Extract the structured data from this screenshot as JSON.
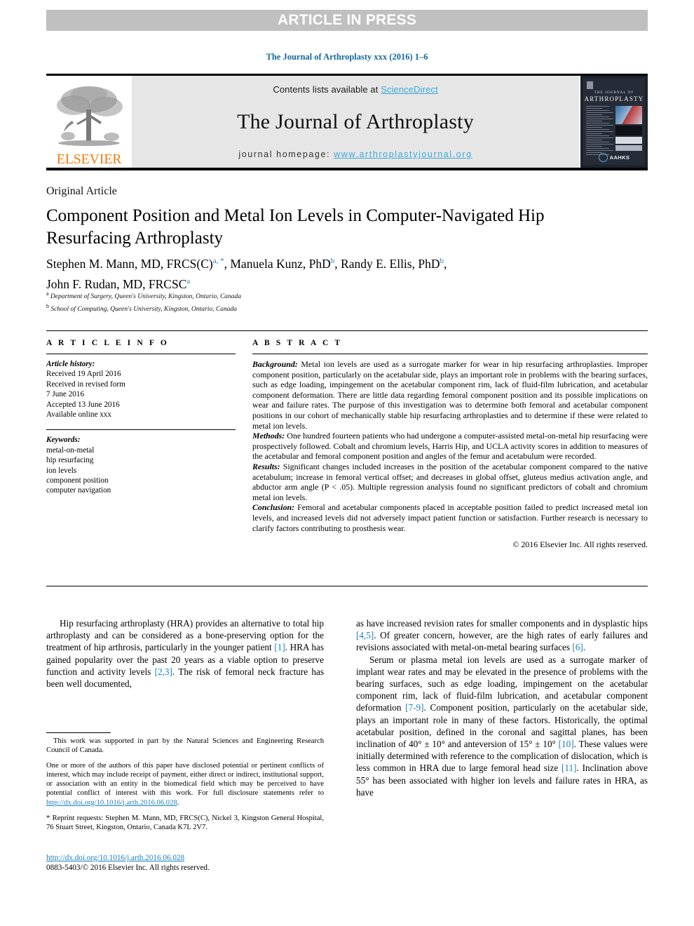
{
  "banner": {
    "text": "ARTICLE IN PRESS"
  },
  "citation_line": "The Journal of Arthroplasty xxx (2016) 1–6",
  "masthead": {
    "contents_prefix": "Contents lists available at ",
    "sciencedirect": "ScienceDirect",
    "journal_name": "The Journal of Arthroplasty",
    "homepage_prefix": "journal homepage: ",
    "homepage_url": "www.arthroplastyjournal.org",
    "elsevier_wordmark": "ELSEVIER",
    "cover": {
      "line1": "THE JOURNAL OF",
      "line2": "ARTHROPLASTY",
      "society": "AAHKS"
    }
  },
  "article": {
    "type": "Original Article",
    "title": "Component Position and Metal Ion Levels in Computer-Navigated Hip Resurfacing Arthroplasty",
    "authors_line1": "Stephen M. Mann, MD, FRCS(C)",
    "authors_line1_sup": "a, *",
    "authors_line1b": ", Manuela Kunz, PhD",
    "authors_line1b_sup": "b",
    "authors_line1c": ", Randy E. Ellis, PhD",
    "authors_line1c_sup": "b",
    "authors_line1d": ",",
    "authors_line2": "John F. Rudan, MD, FRCSC",
    "authors_line2_sup": "a",
    "affiliation_a_sup": "a",
    "affiliation_a": " Department of Surgery, Queen's University, Kingston, Ontario, Canada",
    "affiliation_b_sup": "b",
    "affiliation_b": " School of Computing, Queen's University, Kingston, Ontario, Canada"
  },
  "article_info": {
    "heading": "A R T I C L E   I N F O",
    "history_label": "Article history:",
    "history": [
      "Received 19 April 2016",
      "Received in revised form",
      "7 June 2016",
      "Accepted 13 June 2016",
      "Available online xxx"
    ],
    "keywords_label": "Keywords:",
    "keywords": [
      "metal-on-metal",
      "hip resurfacing",
      "ion levels",
      "component position",
      "computer navigation"
    ]
  },
  "abstract": {
    "heading": "A B S T R A C T",
    "background_label": "Background:",
    "background": " Metal ion levels are used as a surrogate marker for wear in hip resurfacing arthroplasties. Improper component position, particularly on the acetabular side, plays an important role in problems with the bearing surfaces, such as edge loading, impingement on the acetabular component rim, lack of fluid-film lubrication, and acetabular component deformation. There are little data regarding femoral component position and its possible implications on wear and failure rates. The purpose of this investigation was to determine both femoral and acetabular component positions in our cohort of mechanically stable hip resurfacing arthroplasties and to determine if these were related to metal ion levels.",
    "methods_label": "Methods:",
    "methods": " One hundred fourteen patients who had undergone a computer-assisted metal-on-metal hip resurfacing were prospectively followed. Cobalt and chromium levels, Harris Hip, and UCLA activity scores in addition to measures of the acetabular and femoral component position and angles of the femur and acetabulum were recorded.",
    "results_label": "Results:",
    "results": " Significant changes included increases in the position of the acetabular component compared to the native acetabulum; increase in femoral vertical offset; and decreases in global offset, gluteus medius activation angle, and abductor arm angle (P < .05). Multiple regression analysis found no significant predictors of cobalt and chromium metal ion levels.",
    "conclusion_label": "Conclusion:",
    "conclusion": " Femoral and acetabular components placed in acceptable position failed to predict increased metal ion levels, and increased levels did not adversely impact patient function or satisfaction. Further research is necessary to clarify factors contributing to prosthesis wear.",
    "copyright": "© 2016 Elsevier Inc. All rights reserved."
  },
  "body": {
    "left_paragraph_1_a": "Hip resurfacing arthroplasty (HRA) provides an alternative to total hip arthroplasty and can be considered as a bone-preserving option for the treatment of hip arthrosis, particularly in the younger patient ",
    "left_ref_1": "[1]",
    "left_paragraph_1_b": ". HRA has gained popularity over the past 20 years as a viable option to preserve function and activity levels ",
    "left_ref_2": "[2,3]",
    "left_paragraph_1_c": ". The risk of femoral neck fracture has been well documented,",
    "right_paragraph_1_a": "as have increased revision rates for smaller components and in dysplastic hips ",
    "right_ref_1": "[4,5]",
    "right_paragraph_1_b": ". Of greater concern, however, are the high rates of early failures and revisions associated with metal-on-metal bearing surfaces ",
    "right_ref_2": "[6]",
    "right_paragraph_1_c": ".",
    "right_paragraph_2_a": "Serum or plasma metal ion levels are used as a surrogate marker of implant wear rates and may be elevated in the presence of problems with the bearing surfaces, such as edge loading, impingement on the acetabular component rim, lack of fluid-film lubrication, and acetabular component deformation ",
    "right_ref_3": "[7-9]",
    "right_paragraph_2_b": ". Component position, particularly on the acetabular side, plays an important role in many of these factors. Historically, the optimal acetabular position, defined in the coronal and sagittal planes, has been inclination of 40° ± 10° and anteversion of 15° ± 10° ",
    "right_ref_4": "[10]",
    "right_paragraph_2_c": ". These values were initially determined with reference to the complication of dislocation, which is less common in HRA due to large femoral head size ",
    "right_ref_5": "[11]",
    "right_paragraph_2_d": ". Inclination above 55° has been associated with higher ion levels and failure rates in HRA, as have"
  },
  "footnotes": {
    "funding": "This work was supported in part by the Natural Sciences and Engineering Research Council of Canada.",
    "disclosure_a": "One or more of the authors of this paper have disclosed potential or pertinent conflicts of interest, which may include receipt of payment, either direct or indirect, institutional support, or association with an entity in the biomedical field which may be perceived to have potential conflict of interest with this work. For full disclosure statements refer to ",
    "disclosure_link": "http://dx.doi.org/10.1016/j.arth.2016.06.028",
    "disclosure_end": ".",
    "reprint_star": "*",
    "reprint": " Reprint requests: Stephen M. Mann, MD, FRCS(C), Nickel 3, Kingston General Hospital, 76 Stuart Street, Kingston, Ontario, Canada K7L 2V7."
  },
  "doi_block": {
    "doi": "http://dx.doi.org/10.1016/j.arth.2016.06.028",
    "issn_line": "0883-5403/© 2016 Elsevier Inc. All rights reserved."
  },
  "colors": {
    "link_blue": "#1a7fbe",
    "sciencedirect_blue": "#3ba9dd",
    "elsevier_orange": "#ef7d11",
    "banner_gray": "#c0c0c0",
    "masthead_gray": "#e6e6e6"
  }
}
